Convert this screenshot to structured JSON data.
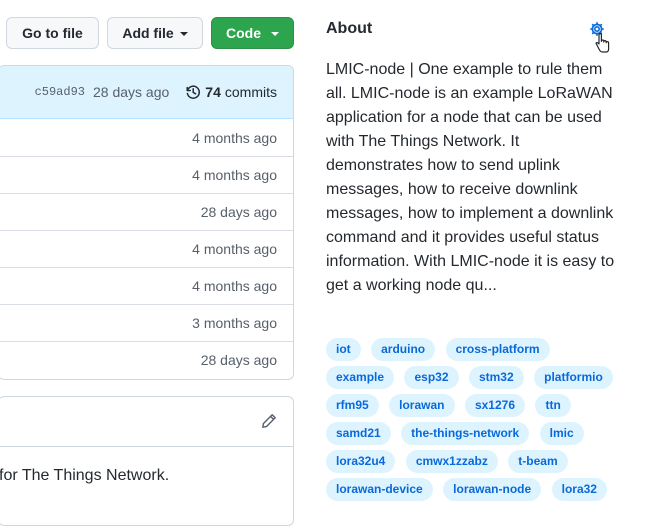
{
  "toolbar": {
    "go_to_file": "Go to file",
    "add_file": "Add file",
    "code": "Code"
  },
  "latest_commit": {
    "sha": "c59ad93",
    "age": "28 days ago",
    "commit_count": "74",
    "commits_label": "commits"
  },
  "files": [
    {
      "age": "4 months ago"
    },
    {
      "age": "4 months ago"
    },
    {
      "age": "28 days ago"
    },
    {
      "age": "4 months ago"
    },
    {
      "age": "4 months ago"
    },
    {
      "age": "3 months ago"
    },
    {
      "age": "28 days ago"
    }
  ],
  "readme": {
    "text": "for The Things Network."
  },
  "about": {
    "title": "About",
    "description": "LMIC-node | One example to rule them all. LMIC-node is an example LoRaWAN application for a node that can be used with The Things Network. It demonstrates how to send uplink messages, how to receive downlink messages, how to implement a downlink command and it provides useful status information. With LMIC-node it is easy to get a working node qu...",
    "topics": [
      "iot",
      "arduino",
      "cross-platform",
      "example",
      "esp32",
      "stm32",
      "platformio",
      "rfm95",
      "lorawan",
      "sx1276",
      "ttn",
      "samd21",
      "the-things-network",
      "lmic",
      "lora32u4",
      "cmwx1zzabz",
      "t-beam",
      "lorawan-device",
      "lorawan-node",
      "lora32"
    ]
  },
  "colors": {
    "accent": "#0969da",
    "code_button": "#2da44e",
    "topic_bg": "#ddf4ff"
  },
  "icons": [
    "caret-down-icon",
    "history-icon",
    "pencil-icon",
    "gear-icon"
  ]
}
